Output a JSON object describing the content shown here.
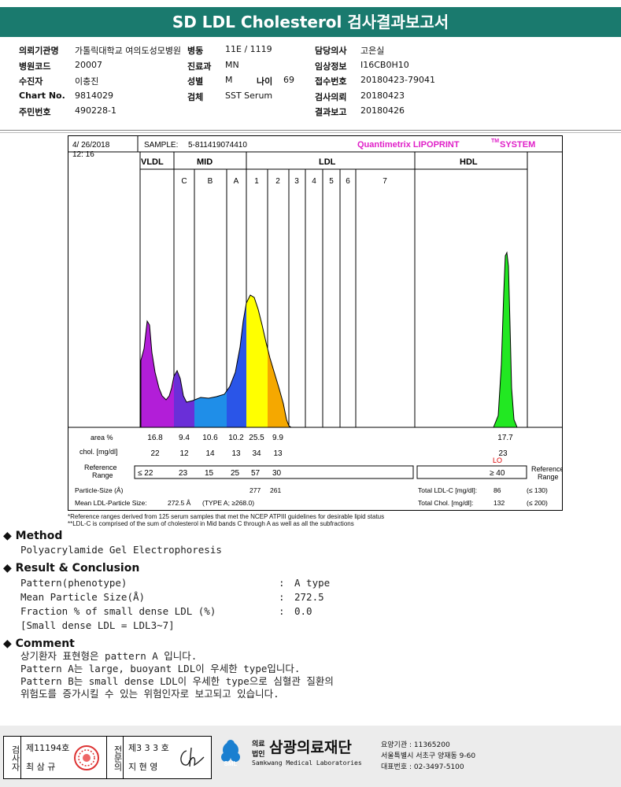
{
  "header": {
    "title": "SD LDL Cholesterol 검사결과보고서"
  },
  "info": {
    "col1": [
      {
        "label": "의뢰기관명",
        "value": "가톨릭대학교 여의도성모병원"
      },
      {
        "label": "병원코드",
        "value": "20007"
      },
      {
        "label": "수진자",
        "value": "이충진"
      },
      {
        "label": "Chart No.",
        "value": "9814029"
      },
      {
        "label": "주민번호",
        "value": "490228-1"
      }
    ],
    "col2": [
      {
        "label": "병동",
        "value": "11E / 1119"
      },
      {
        "label": "진료과",
        "value": "MN"
      },
      {
        "label": "성별",
        "value": "M"
      },
      {
        "label": "검체",
        "value": "SST Serum"
      }
    ],
    "age": {
      "label": "나이",
      "value": "69"
    },
    "col3": [
      {
        "label": "담당의사",
        "value": "고은실"
      },
      {
        "label": "임상정보",
        "value": "I16CB0H10"
      },
      {
        "label": "접수번호",
        "value": "20180423-79041"
      },
      {
        "label": "검사의뢰",
        "value": "20180423"
      },
      {
        "label": "결과보고",
        "value": "20180426"
      }
    ]
  },
  "chart": {
    "date": "4/ 26/2018",
    "time": "12: 16",
    "sample_label": "SAMPLE:",
    "sample_id": "5-811419074410",
    "brand": "Quantimetrix LIPOPRINT",
    "brand_tm": "TM",
    "brand_suffix": "SYSTEM",
    "region_labels": [
      "VLDL",
      "MID",
      "LDL",
      "HDL"
    ],
    "band_labels": [
      "C",
      "B",
      "A",
      "1",
      "2",
      "3",
      "4",
      "5",
      "6",
      "7"
    ],
    "row_area_label": "area %",
    "row_chol_label": "chol. [mg/dl]",
    "row_ref_label": "Reference Range",
    "area_values": [
      "16.8",
      "9.4",
      "10.6",
      "10.2",
      "25.5",
      "9.9"
    ],
    "hdl_area": "17.7",
    "chol_values": [
      "22",
      "12",
      "14",
      "13",
      "34",
      "13"
    ],
    "hdl_chol": "23",
    "hdl_flag": "LO",
    "ref_values": [
      "≤ 22",
      "23",
      "15",
      "25",
      "57",
      "30"
    ],
    "hdl_ref": "≥ 40",
    "ref_range_right": "Reference Range",
    "particle_size_label": "Particle-Size (Å)",
    "particle_sizes": [
      "277",
      "261"
    ],
    "mean_ldl_label": "Mean LDL-Particle Size:",
    "mean_ldl_value": "272.5 Å",
    "mean_ldl_type": "(TYPE A; ≥268.0)",
    "total_ldl_label": "Total LDL-C [mg/dl]:",
    "total_ldl_value": "86",
    "total_ldl_ref": "(≤ 130)",
    "total_chol_label": "Total Chol. [mg/dl]:",
    "total_chol_value": "132",
    "total_chol_ref": "(≤ 200)",
    "footnote1": "*Reference ranges derived from 125 serum samples that met the NCEP ATPIII guidelines for desirable lipid status",
    "footnote2": "**LDL-C is comprised of the sum of cholesterol in Mid bands C through A as well as all the subfractions"
  },
  "method": {
    "heading": "Method",
    "text": "Polyacrylamide Gel Electrophoresis"
  },
  "result": {
    "heading": "Result & Conclusion",
    "rows": [
      {
        "label": "Pattern(phenotype)",
        "sep": ":",
        "value": "A type"
      },
      {
        "label": "Mean Particle Size(Å)",
        "sep": ":",
        "value": "272.5"
      },
      {
        "label": "Fraction % of small dense LDL (%)",
        "sep": ":",
        "value": "0.0"
      }
    ],
    "note": "[Small dense LDL = LDL3~7]"
  },
  "comment": {
    "heading": "Comment",
    "lines": [
      "상기환자 표현형은 pattern A 입니다.",
      "Pattern A는 large, buoyant LDL이 우세한 type입니다.",
      "Pattern B는 small dense LDL이 우세한 type으로 심혈관 질환의",
      "위험도를 증가시킬 수 있는 위험인자로 보고되고 있습니다."
    ]
  },
  "footer": {
    "inspector_label": "검사자",
    "inspector_no": "제11194호",
    "inspector_name": "최 삼 규",
    "specialist_label": "전문의",
    "specialist_no": "제3 3 3 호",
    "specialist_name": "지 현 영",
    "org_prefix_top": "의료",
    "org_prefix_bottom": "법인",
    "org_name": "삼광의료재단",
    "org_en": "Samkwang Medical Laboratories",
    "logo_text": "SML",
    "code_line": "요양기관 : 11365200",
    "address": "서울특별시 서초구 양재동 9-60",
    "phone": "대표번호 : 02-3497-5100"
  },
  "colors": {
    "header_bg": "#1a7a6e",
    "vldl": "#b21ed8",
    "mid_c": "#6a2fd8",
    "mid_b": "#1f8ee8",
    "mid_a": "#2a55e8",
    "ldl1": "#ffff00",
    "ldl2": "#f5a800",
    "hdl": "#22e822",
    "brand": "#e020c8"
  }
}
